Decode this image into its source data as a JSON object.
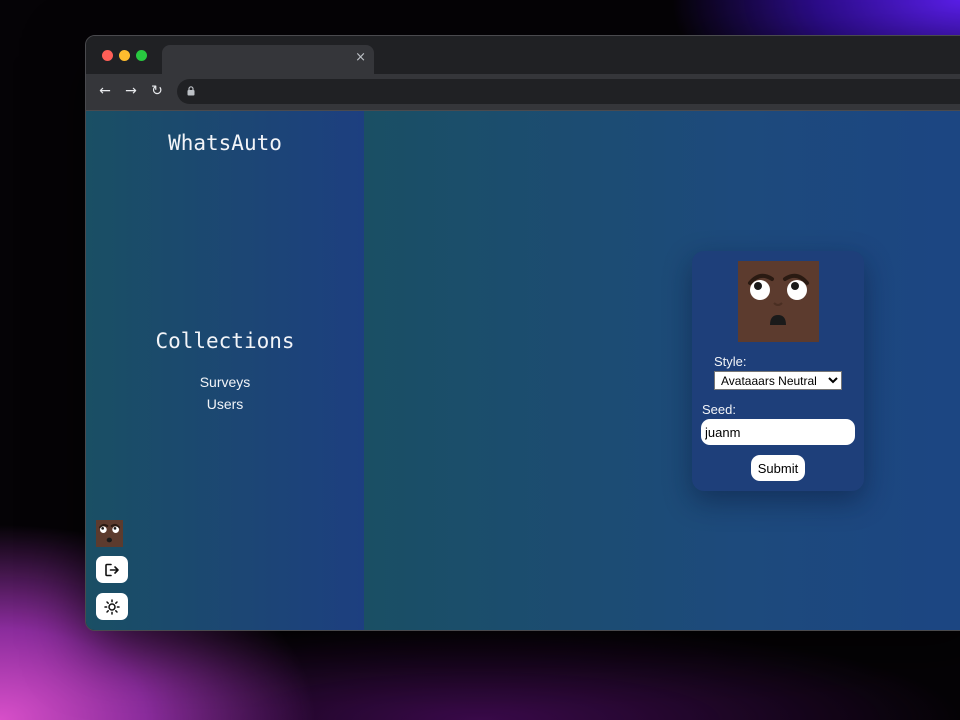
{
  "browser": {
    "tab_close_glyph": "×",
    "nav_back_glyph": "←",
    "nav_forward_glyph": "→",
    "nav_reload_glyph": "↻",
    "url": ""
  },
  "sidebar": {
    "brand": "WhatsAuto",
    "section_title": "Collections",
    "links": [
      {
        "label": "Surveys"
      },
      {
        "label": "Users"
      }
    ],
    "icons": [
      "avatar-thumbnail",
      "logout-icon",
      "sun-icon"
    ]
  },
  "avatar_form": {
    "style_label": "Style:",
    "style_selected": "Avataaars Neutral",
    "seed_label": "Seed:",
    "seed_value": "juanm",
    "submit_label": "Submit"
  },
  "colors": {
    "sidebar_gradient": [
      "#1a4f64",
      "#1d3f80"
    ],
    "card_bg": "#1e3f7a",
    "avatar_skin": "#5c3b2e"
  }
}
